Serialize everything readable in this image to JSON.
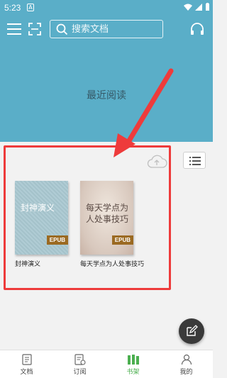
{
  "status_bar": {
    "time": "5:23",
    "notif_glyph": "A"
  },
  "header": {
    "search_placeholder": "搜索文档",
    "recent_title": "最近阅读"
  },
  "books": [
    {
      "title": "封神演义",
      "cover_lines": [
        "封神演义"
      ],
      "badge": "EPUB"
    },
    {
      "title": "每天学点为人处事技巧",
      "cover_lines": [
        "每天学点为",
        "人处事技巧"
      ],
      "badge": "EPUB"
    }
  ],
  "bottom_nav": [
    {
      "label": "文档",
      "icon": "document-icon",
      "active": false
    },
    {
      "label": "订阅",
      "icon": "subscribe-icon",
      "active": false
    },
    {
      "label": "书架",
      "icon": "bookshelf-icon",
      "active": true
    },
    {
      "label": "我的",
      "icon": "profile-icon",
      "active": false
    }
  ],
  "colors": {
    "header_bg": "#5aaec8",
    "highlight": "#ee3b3b",
    "active_nav": "#4caf50",
    "badge": "#9b6a22"
  }
}
